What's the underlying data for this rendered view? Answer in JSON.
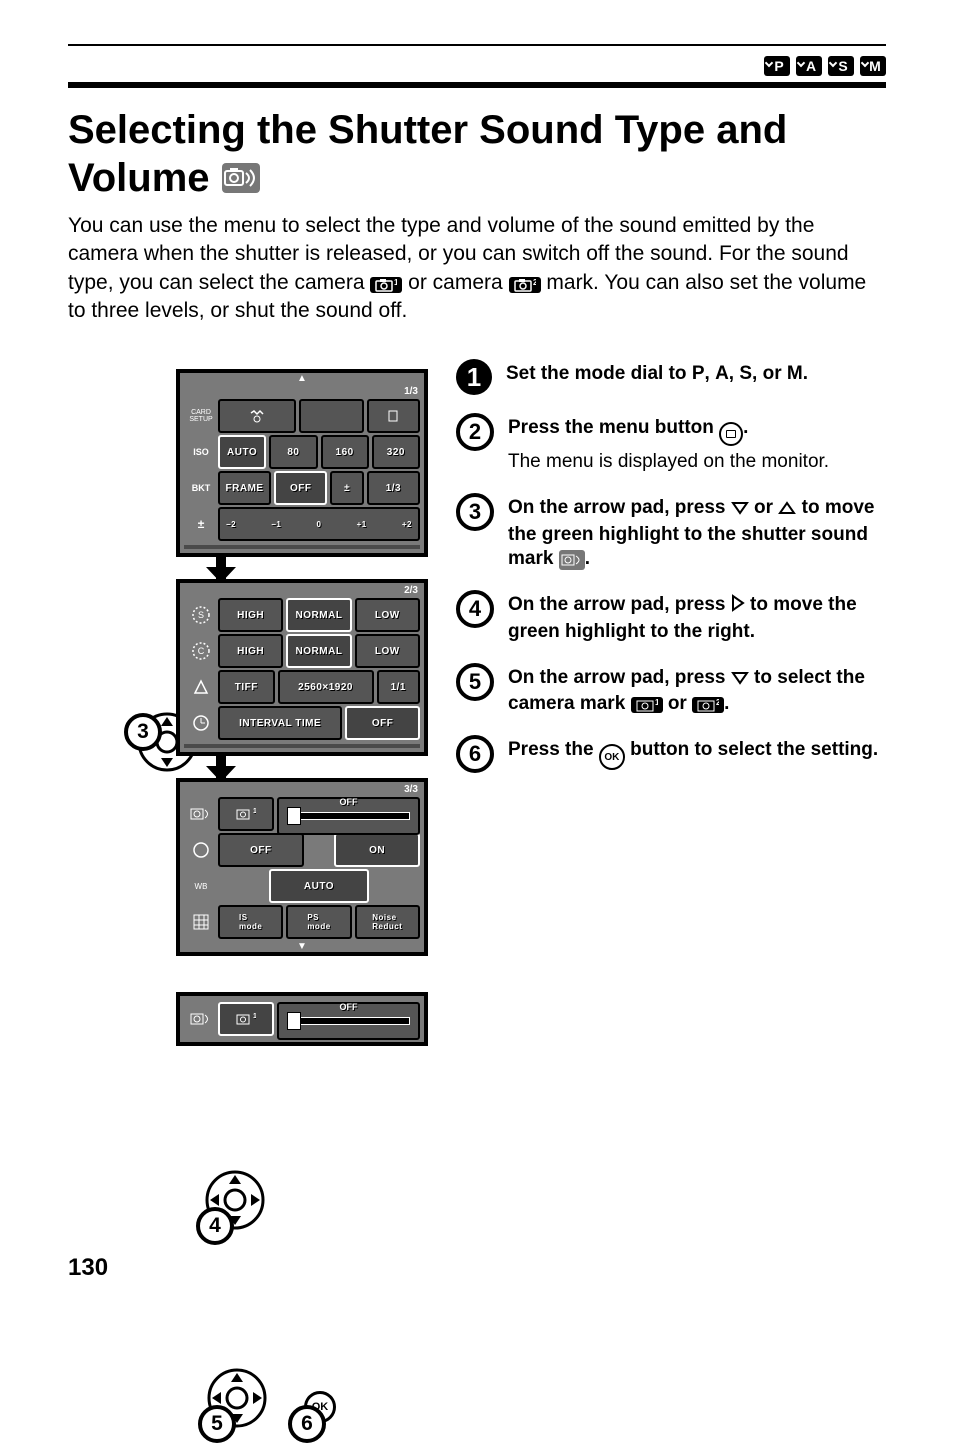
{
  "mode_badges": [
    "P",
    "A",
    "S",
    "M"
  ],
  "title_line1": "Selecting the Shutter Sound Type and",
  "title_line2": "Volume",
  "intro_part1": "You can use the menu to select the type and volume of the sound emitted by the camera when the shutter is released, or you can switch off the sound. For the sound type, you can select the camera ",
  "intro_part2": " or camera ",
  "intro_part3": " mark. You can also set the volume to three levels, or shut the sound off.",
  "screens": {
    "s1": {
      "hdr": "1/3",
      "rows": [
        {
          "icon": "CARD SETUP",
          "cells": [
            "",
            "",
            ""
          ]
        },
        {
          "icon": "ISO",
          "cells": [
            "AUTO",
            "80",
            "160",
            "320"
          ]
        },
        {
          "icon": "BKT",
          "cells": [
            "FRAME",
            "OFF",
            "±",
            "1/3"
          ]
        },
        {
          "icon": "±",
          "cells": [
            "−2",
            "−1",
            "0",
            "+1",
            "+2"
          ]
        }
      ]
    },
    "s2": {
      "hdr": "2/3",
      "rows": [
        {
          "icon": "S",
          "cells": [
            "HIGH",
            "NORMAL",
            "LOW"
          ]
        },
        {
          "icon": "C",
          "cells": [
            "HIGH",
            "NORMAL",
            "LOW"
          ]
        },
        {
          "icon": "res",
          "cells": [
            "TIFF",
            "2560×1920",
            "1/1"
          ]
        },
        {
          "icon": "clock",
          "cells": [
            "INTERVAL TIME",
            "OFF"
          ]
        }
      ]
    },
    "s3": {
      "hdr": "3/3",
      "rows": [
        {
          "icon": "shutter",
          "cells": [
            "cam1",
            "OFF_SLIDER",
            ""
          ]
        },
        {
          "icon": "lamp",
          "cells": [
            "OFF",
            "",
            "ON"
          ]
        },
        {
          "icon": "wb",
          "cells": [
            "",
            "AUTO",
            ""
          ]
        },
        {
          "icon": "grid",
          "cells": [
            "IS mode",
            "PS mode",
            "Noise Reduct"
          ]
        }
      ]
    },
    "s4": {
      "rows": [
        {
          "icon": "shutter",
          "cells": [
            "cam1",
            "OFF_SLIDER",
            ""
          ]
        }
      ]
    }
  },
  "steps": [
    {
      "n": "1",
      "style": "solid",
      "lead": "Set the mode dial to P, A, S, or M."
    },
    {
      "n": "2",
      "style": "outline",
      "lead": "Press the menu button ",
      "tail_icon": "menu-button",
      "tail": ".",
      "sub": "The menu is displayed on the monitor."
    },
    {
      "n": "3",
      "style": "outline",
      "lead_parts": [
        "On the arrow pad, press ",
        "tri-down",
        " or ",
        "tri-up",
        " to move the green highlight to the shutter sound mark ",
        "shutter-icon",
        "."
      ]
    },
    {
      "n": "4",
      "style": "outline",
      "lead_parts": [
        "On the arrow pad, press ",
        "tri-right",
        " to move the green highlight to the right."
      ]
    },
    {
      "n": "5",
      "style": "outline",
      "lead_parts": [
        "On the arrow pad, press ",
        "tri-down",
        " to select the camera mark ",
        "cam1",
        " or ",
        "cam2",
        "."
      ]
    },
    {
      "n": "6",
      "style": "outline",
      "lead_parts": [
        "Press the ",
        "ok-circle",
        " button to select the setting."
      ]
    }
  ],
  "ok_label": "OK",
  "page_number": "130"
}
